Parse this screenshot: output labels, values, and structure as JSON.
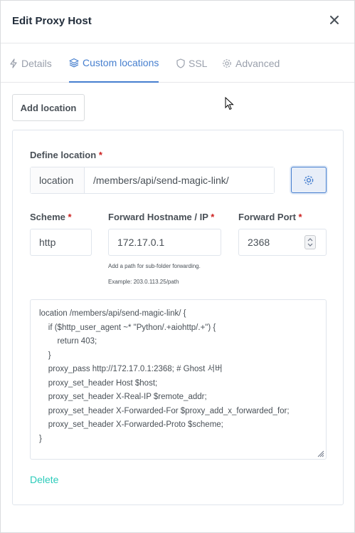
{
  "dialog": {
    "title": "Edit Proxy Host"
  },
  "tabs": [
    {
      "label": "Details",
      "icon": "bolt-icon",
      "active": false
    },
    {
      "label": "Custom locations",
      "icon": "layers-icon",
      "active": true
    },
    {
      "label": "SSL",
      "icon": "shield-icon",
      "active": false
    },
    {
      "label": "Advanced",
      "icon": "gear-icon",
      "active": false
    }
  ],
  "add_location_label": "Add location",
  "location": {
    "define_label": "Define location",
    "required_mark": "*",
    "prefix": "location",
    "path": "/members/api/send-magic-link/",
    "scheme_label": "Scheme",
    "scheme_value": "http",
    "hostname_label": "Forward Hostname / IP",
    "hostname_value": "172.17.0.1",
    "port_label": "Forward Port",
    "port_value": "2368",
    "hint_line1": "Add a path for sub-folder forwarding.",
    "hint_line2": "Example: 203.0.113.25/path",
    "config": "location /members/api/send-magic-link/ {\n    if ($http_user_agent ~* \"Python/.+aiohttp/.+\") {\n        return 403;\n    }\n    proxy_pass http://172.17.0.1:2368; # Ghost 서버\n    proxy_set_header Host $host;\n    proxy_set_header X-Real-IP $remote_addr;\n    proxy_set_header X-Forwarded-For $proxy_add_x_forwarded_for;\n    proxy_set_header X-Forwarded-Proto $scheme;\n}",
    "delete_label": "Delete"
  },
  "colors": {
    "accent": "#467fcf",
    "danger": "#cd201f",
    "delete": "#2bcbba",
    "muted": "#9aa0ac"
  }
}
